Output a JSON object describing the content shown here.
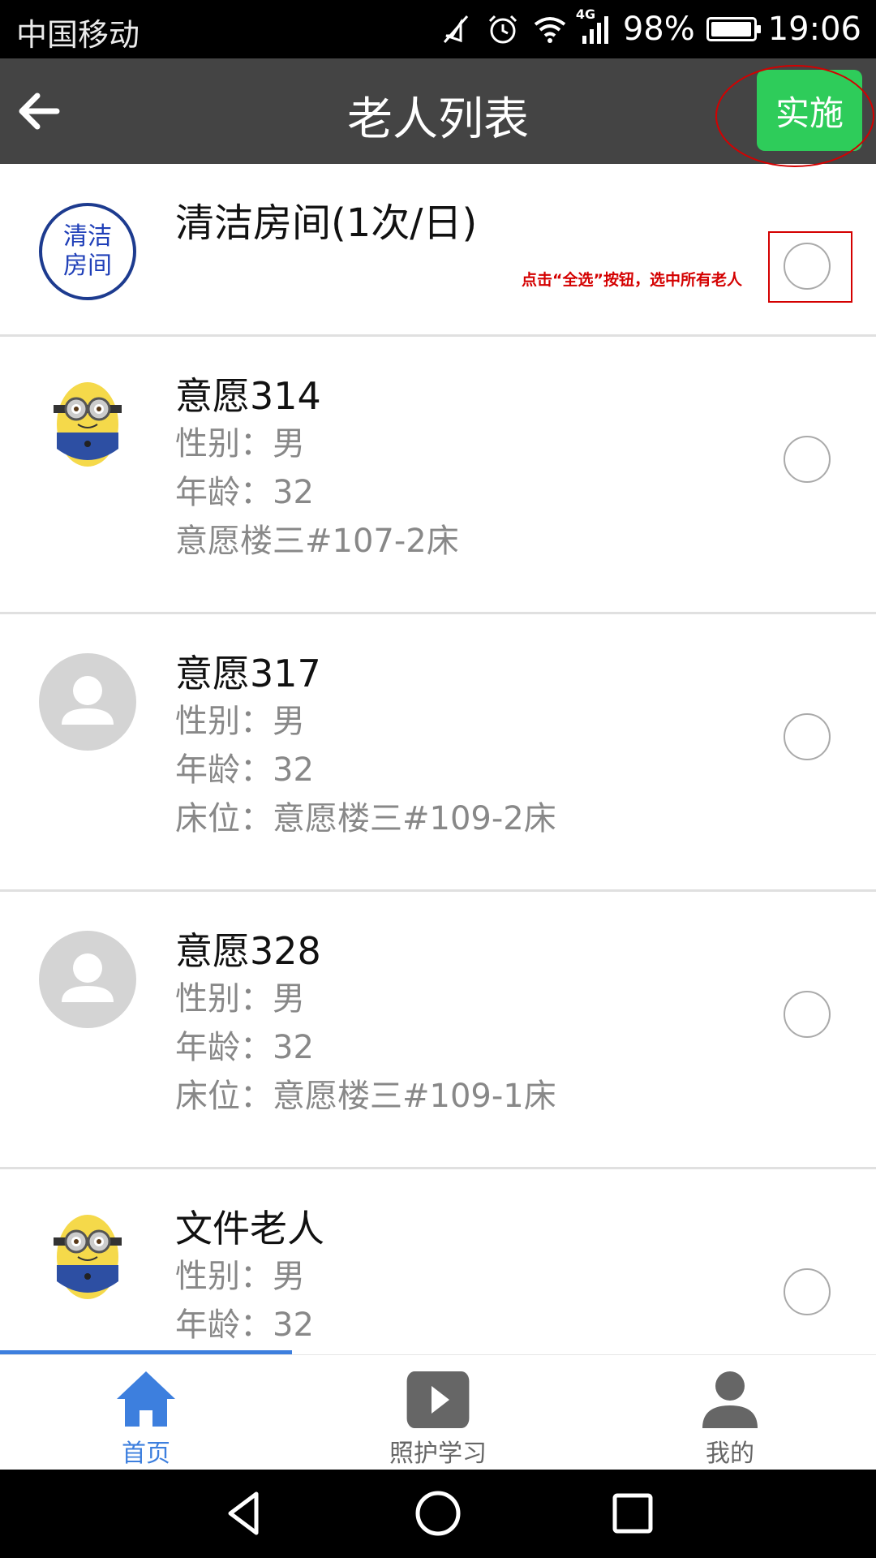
{
  "status_bar": {
    "carrier": "中国移动",
    "network": "4G",
    "battery_percent": "98%",
    "battery_level": 0.98,
    "time": "19:06",
    "icons": [
      "mute-icon",
      "alarm-icon",
      "wifi-icon",
      "signal-icon",
      "battery-icon"
    ]
  },
  "header": {
    "title": "老人列表",
    "back_icon": "arrow-left-icon",
    "action_label": "实施",
    "action_color": "#2ecc5a"
  },
  "task": {
    "logo_text": "清洁房间",
    "title": "清洁房间(1次/日)",
    "annotation": "点击“全选”按钮，选中所有老人"
  },
  "elders": [
    {
      "name": "意愿314",
      "gender": "性别：男",
      "age": "年龄：32",
      "bed": "意愿楼三#107-2床",
      "avatar": "minion"
    },
    {
      "name": "意愿317",
      "gender": "性别：男",
      "age": "年龄：32",
      "bed": "床位：意愿楼三#109-2床",
      "avatar": "default-person"
    },
    {
      "name": "意愿328",
      "gender": "性别：男",
      "age": "年龄：32",
      "bed": "床位：意愿楼三#109-1床",
      "avatar": "default-person"
    },
    {
      "name": "文件老人",
      "gender": "性别：男",
      "age": "年龄：32",
      "avatar": "minion"
    }
  ],
  "tabs": [
    {
      "label": "首页",
      "icon": "home-icon",
      "active": true
    },
    {
      "label": "照护学习",
      "icon": "video-play-icon",
      "active": false
    },
    {
      "label": "我的",
      "icon": "user-icon",
      "active": false
    }
  ],
  "colors": {
    "header_bg": "#444444",
    "accent": "#3d7fde",
    "annotation_red": "#d40000"
  }
}
